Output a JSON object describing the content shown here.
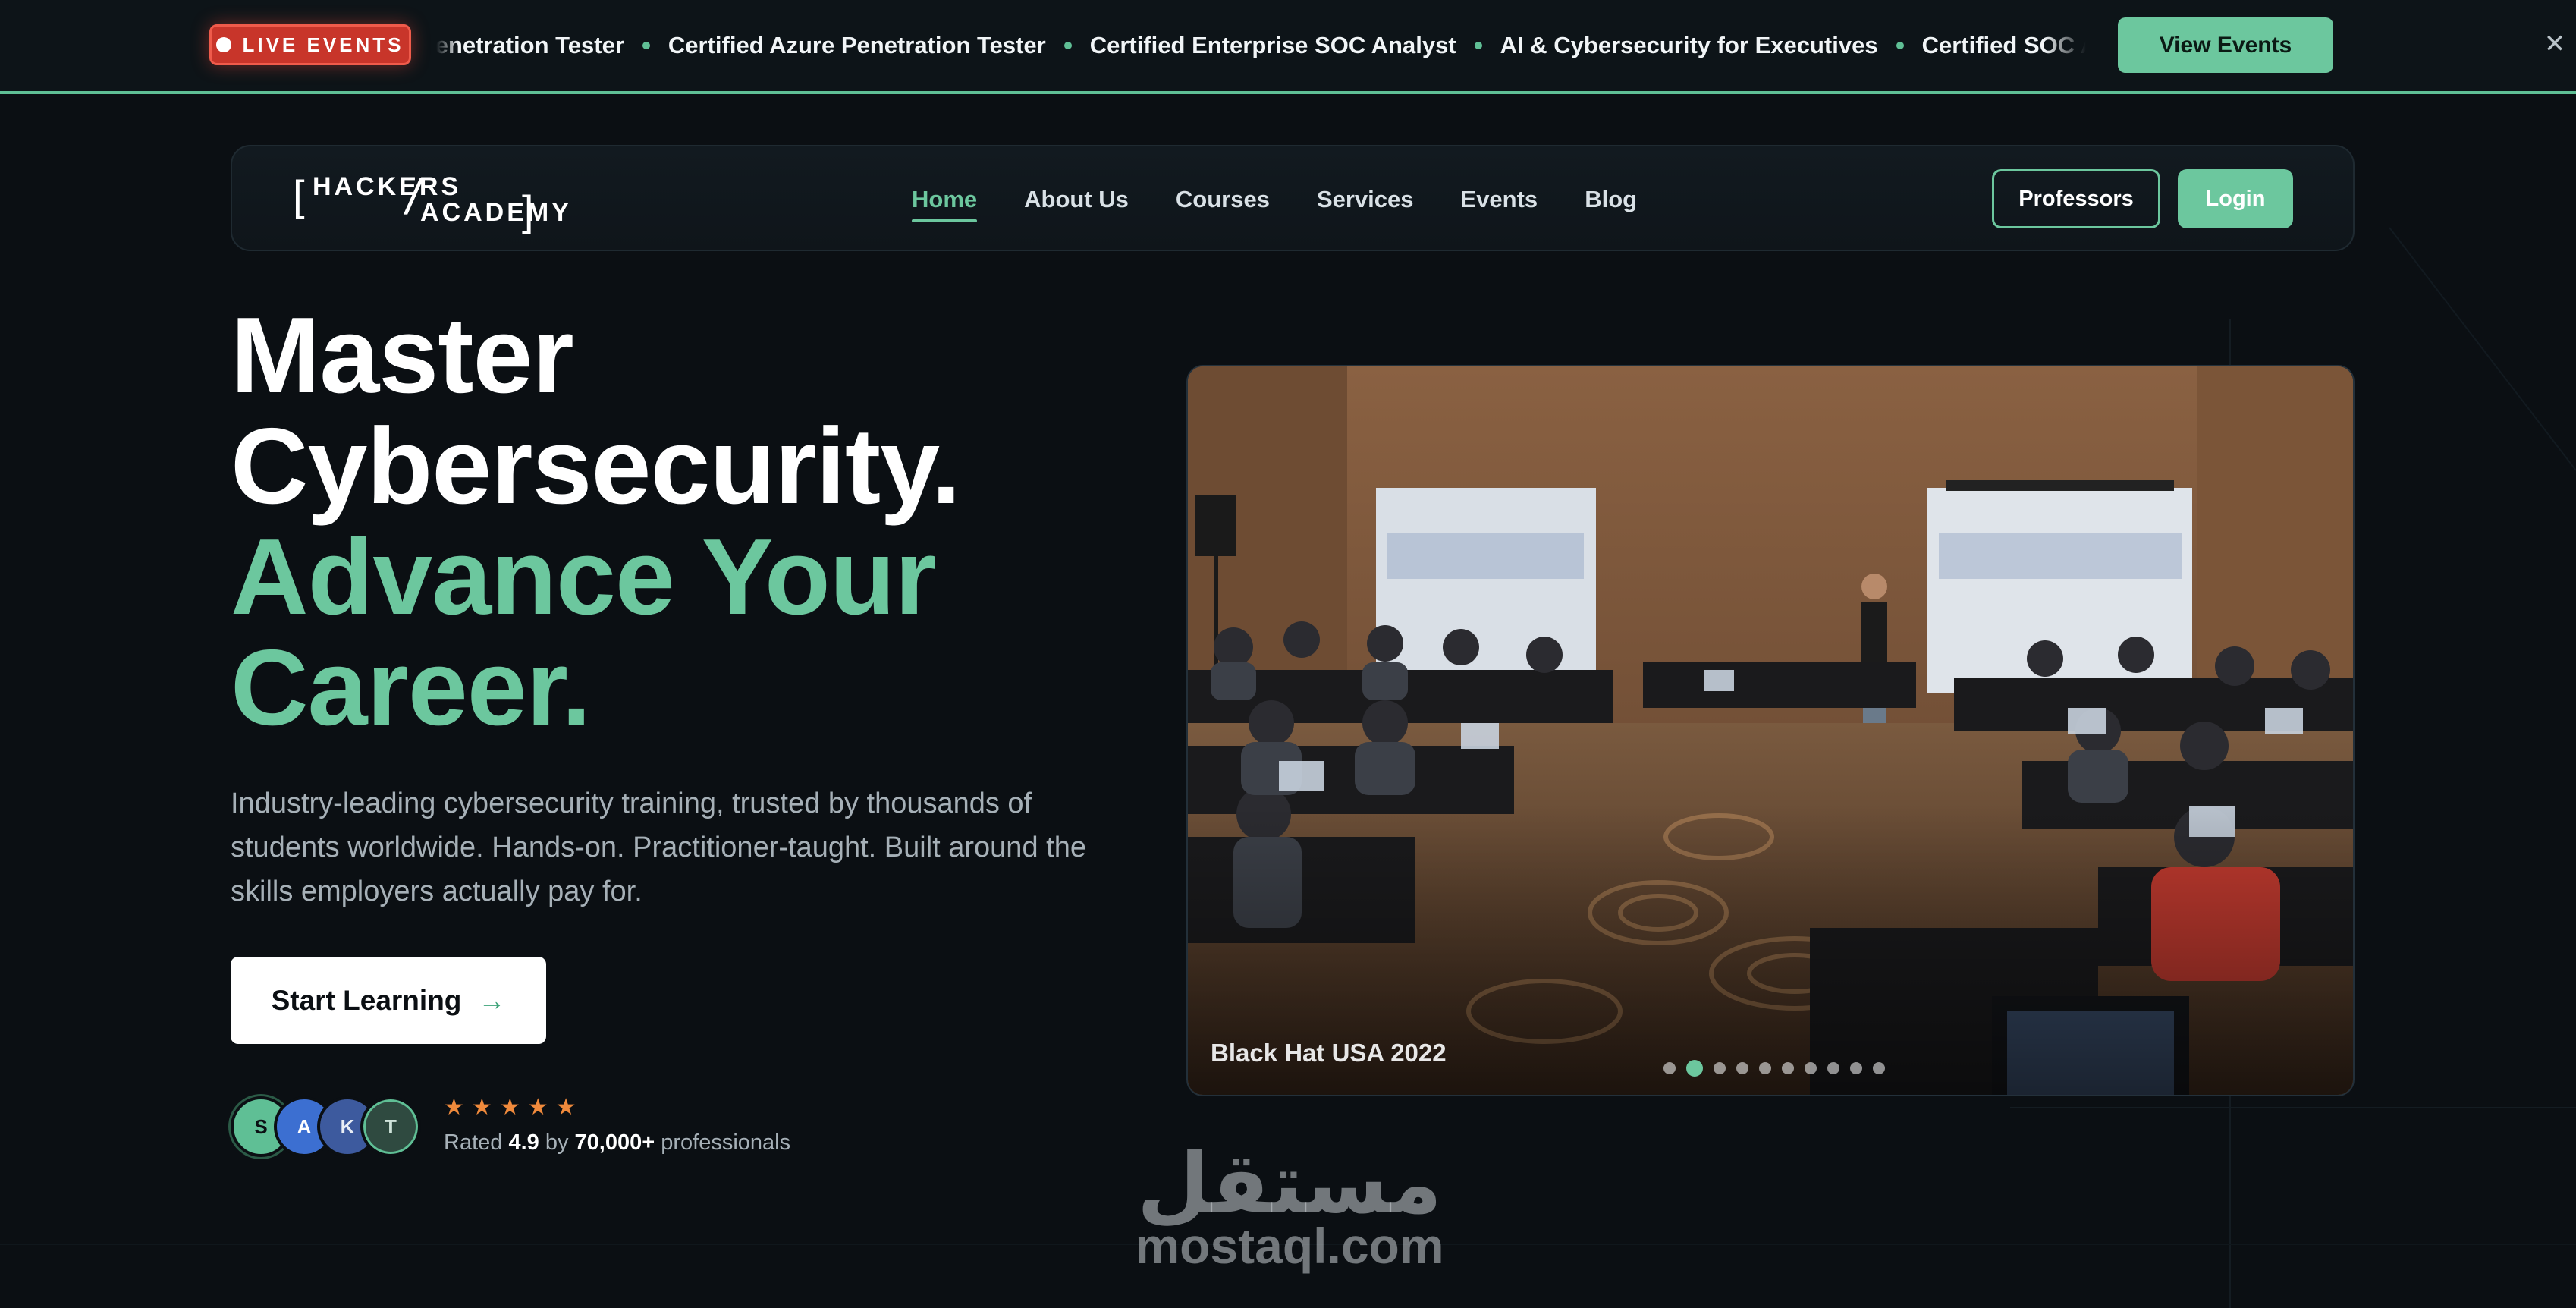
{
  "announcement": {
    "badge": "LIVE EVENTS",
    "ticker": [
      "Penetration Tester",
      "Certified Azure Penetration Tester",
      "Certified Enterprise SOC Analyst",
      "AI & Cybersecurity for Executives",
      "Certified SOC Analyst"
    ],
    "cta": "View Events",
    "close": "✕"
  },
  "nav": {
    "logo": {
      "word1": "HACKERS",
      "word2": "ACADEMY"
    },
    "links": [
      "Home",
      "About Us",
      "Courses",
      "Services",
      "Events",
      "Blog"
    ],
    "active": "Home",
    "professors": "Professors",
    "login": "Login"
  },
  "hero": {
    "title": [
      "Master",
      "Cybersecurity.",
      "Advance Your",
      "Career."
    ],
    "subtitle": "Industry-leading cybersecurity training, trusted by thousands of students worldwide. Hands-on. Practitioner-taught. Built around the skills employers actually pay for.",
    "cta": "Start Learning",
    "avatars": [
      "S",
      "A",
      "K",
      "T"
    ],
    "stars": 5,
    "rating_prefix": "Rated",
    "rating_value": "4.9",
    "rating_mid": "by",
    "rating_count": "70,000+",
    "rating_suffix": "professionals"
  },
  "slideshow": {
    "caption": "Black Hat USA 2022",
    "slides": 10,
    "active_index": 1
  },
  "watermark": {
    "arabic": "مستقل",
    "latin": "mostaql.com"
  },
  "colors": {
    "accent": "#6cc79e",
    "live": "#c8352a",
    "background": "#0b0f13",
    "star": "#f08a3c"
  }
}
